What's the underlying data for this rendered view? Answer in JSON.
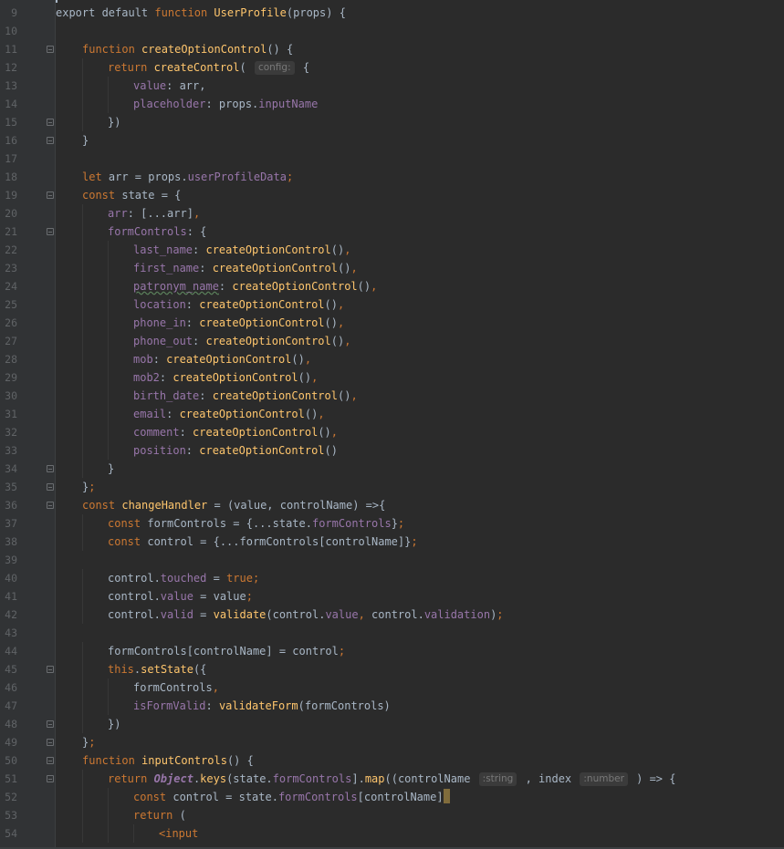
{
  "editor": {
    "lines": [
      {
        "num": "9",
        "indent": 0,
        "fold": false,
        "tokens": [
          [
            "plain",
            "export default "
          ],
          [
            "kw",
            "function "
          ],
          [
            "fn",
            "UserProfile"
          ],
          [
            "plain",
            "(props) {"
          ]
        ]
      },
      {
        "num": "10",
        "indent": 0,
        "fold": false,
        "tokens": []
      },
      {
        "num": "11",
        "indent": 1,
        "fold": true,
        "tokens": [
          [
            "kw",
            "function "
          ],
          [
            "fn",
            "createOptionControl"
          ],
          [
            "plain",
            "() {"
          ]
        ]
      },
      {
        "num": "12",
        "indent": 2,
        "fold": false,
        "tokens": [
          [
            "kw",
            "return "
          ],
          [
            "fn",
            "createControl"
          ],
          [
            "plain",
            "( "
          ],
          [
            "hint",
            "config:"
          ],
          [
            "plain",
            " {"
          ]
        ]
      },
      {
        "num": "13",
        "indent": 3,
        "fold": false,
        "tokens": [
          [
            "prop",
            "value"
          ],
          [
            "plain",
            ": arr,"
          ]
        ]
      },
      {
        "num": "14",
        "indent": 3,
        "fold": false,
        "tokens": [
          [
            "prop",
            "placeholder"
          ],
          [
            "plain",
            ": props."
          ],
          [
            "prop",
            "inputName"
          ]
        ]
      },
      {
        "num": "15",
        "indent": 2,
        "fold": true,
        "tokens": [
          [
            "plain",
            "})"
          ]
        ]
      },
      {
        "num": "16",
        "indent": 1,
        "fold": true,
        "tokens": [
          [
            "plain",
            "}"
          ]
        ]
      },
      {
        "num": "17",
        "indent": 0,
        "fold": false,
        "tokens": []
      },
      {
        "num": "18",
        "indent": 1,
        "fold": false,
        "tokens": [
          [
            "kw",
            "let "
          ],
          [
            "plain",
            "arr = props."
          ],
          [
            "prop",
            "userProfileData"
          ],
          [
            "kw",
            ";"
          ]
        ]
      },
      {
        "num": "19",
        "indent": 1,
        "fold": true,
        "tokens": [
          [
            "kw",
            "const "
          ],
          [
            "plain",
            "state = {"
          ]
        ]
      },
      {
        "num": "20",
        "indent": 2,
        "fold": false,
        "tokens": [
          [
            "prop",
            "arr"
          ],
          [
            "plain",
            ": [...arr]"
          ],
          [
            "kw",
            ","
          ]
        ]
      },
      {
        "num": "21",
        "indent": 2,
        "fold": true,
        "tokens": [
          [
            "prop",
            "formControls"
          ],
          [
            "plain",
            ": {"
          ]
        ]
      },
      {
        "num": "22",
        "indent": 3,
        "fold": false,
        "tokens": [
          [
            "prop",
            "last_name"
          ],
          [
            "plain",
            ": "
          ],
          [
            "fn",
            "createOptionControl"
          ],
          [
            "plain",
            "()"
          ],
          [
            "kw",
            ","
          ]
        ]
      },
      {
        "num": "23",
        "indent": 3,
        "fold": false,
        "tokens": [
          [
            "prop",
            "first_name"
          ],
          [
            "plain",
            ": "
          ],
          [
            "fn",
            "createOptionControl"
          ],
          [
            "plain",
            "()"
          ],
          [
            "kw",
            ","
          ]
        ]
      },
      {
        "num": "24",
        "indent": 3,
        "fold": false,
        "tokens": [
          [
            "propwarn",
            "patronym_name"
          ],
          [
            "plain",
            ": "
          ],
          [
            "fn",
            "createOptionControl"
          ],
          [
            "plain",
            "()"
          ],
          [
            "kw",
            ","
          ]
        ]
      },
      {
        "num": "25",
        "indent": 3,
        "fold": false,
        "tokens": [
          [
            "prop",
            "location"
          ],
          [
            "plain",
            ": "
          ],
          [
            "fn",
            "createOptionControl"
          ],
          [
            "plain",
            "()"
          ],
          [
            "kw",
            ","
          ]
        ]
      },
      {
        "num": "26",
        "indent": 3,
        "fold": false,
        "tokens": [
          [
            "prop",
            "phone_in"
          ],
          [
            "plain",
            ": "
          ],
          [
            "fn",
            "createOptionControl"
          ],
          [
            "plain",
            "()"
          ],
          [
            "kw",
            ","
          ]
        ]
      },
      {
        "num": "27",
        "indent": 3,
        "fold": false,
        "tokens": [
          [
            "prop",
            "phone_out"
          ],
          [
            "plain",
            ": "
          ],
          [
            "fn",
            "createOptionControl"
          ],
          [
            "plain",
            "()"
          ],
          [
            "kw",
            ","
          ]
        ]
      },
      {
        "num": "28",
        "indent": 3,
        "fold": false,
        "tokens": [
          [
            "prop",
            "mob"
          ],
          [
            "plain",
            ": "
          ],
          [
            "fn",
            "createOptionControl"
          ],
          [
            "plain",
            "()"
          ],
          [
            "kw",
            ","
          ]
        ]
      },
      {
        "num": "29",
        "indent": 3,
        "fold": false,
        "tokens": [
          [
            "prop",
            "mob2"
          ],
          [
            "plain",
            ": "
          ],
          [
            "fn",
            "createOptionControl"
          ],
          [
            "plain",
            "()"
          ],
          [
            "kw",
            ","
          ]
        ]
      },
      {
        "num": "30",
        "indent": 3,
        "fold": false,
        "tokens": [
          [
            "prop",
            "birth_date"
          ],
          [
            "plain",
            ": "
          ],
          [
            "fn",
            "createOptionControl"
          ],
          [
            "plain",
            "()"
          ],
          [
            "kw",
            ","
          ]
        ]
      },
      {
        "num": "31",
        "indent": 3,
        "fold": false,
        "tokens": [
          [
            "prop",
            "email"
          ],
          [
            "plain",
            ": "
          ],
          [
            "fn",
            "createOptionControl"
          ],
          [
            "plain",
            "()"
          ],
          [
            "kw",
            ","
          ]
        ]
      },
      {
        "num": "32",
        "indent": 3,
        "fold": false,
        "tokens": [
          [
            "prop",
            "comment"
          ],
          [
            "plain",
            ": "
          ],
          [
            "fn",
            "createOptionControl"
          ],
          [
            "plain",
            "()"
          ],
          [
            "kw",
            ","
          ]
        ]
      },
      {
        "num": "33",
        "indent": 3,
        "fold": false,
        "tokens": [
          [
            "prop",
            "position"
          ],
          [
            "plain",
            ": "
          ],
          [
            "fn",
            "createOptionControl"
          ],
          [
            "plain",
            "()"
          ]
        ]
      },
      {
        "num": "34",
        "indent": 2,
        "fold": true,
        "tokens": [
          [
            "plain",
            "}"
          ]
        ]
      },
      {
        "num": "35",
        "indent": 1,
        "fold": true,
        "tokens": [
          [
            "plain",
            "}"
          ],
          [
            "kw",
            ";"
          ]
        ]
      },
      {
        "num": "36",
        "indent": 1,
        "fold": true,
        "tokens": [
          [
            "kw",
            "const "
          ],
          [
            "fn",
            "changeHandler"
          ],
          [
            "plain",
            " = (value, controlName) =>{"
          ]
        ]
      },
      {
        "num": "37",
        "indent": 2,
        "fold": false,
        "tokens": [
          [
            "kw",
            "const "
          ],
          [
            "plain",
            "formControls = {...state."
          ],
          [
            "prop",
            "formControls"
          ],
          [
            "plain",
            "}"
          ],
          [
            "kw",
            ";"
          ]
        ]
      },
      {
        "num": "38",
        "indent": 2,
        "fold": false,
        "tokens": [
          [
            "kw",
            "const "
          ],
          [
            "plain",
            "control = {...formControls[controlName]}"
          ],
          [
            "kw",
            ";"
          ]
        ]
      },
      {
        "num": "39",
        "indent": 0,
        "fold": false,
        "tokens": []
      },
      {
        "num": "40",
        "indent": 2,
        "fold": false,
        "tokens": [
          [
            "plain",
            "control."
          ],
          [
            "prop",
            "touched"
          ],
          [
            "plain",
            " = "
          ],
          [
            "kw",
            "true;"
          ]
        ]
      },
      {
        "num": "41",
        "indent": 2,
        "fold": false,
        "tokens": [
          [
            "plain",
            "control."
          ],
          [
            "prop",
            "value"
          ],
          [
            "plain",
            " = value"
          ],
          [
            "kw",
            ";"
          ]
        ]
      },
      {
        "num": "42",
        "indent": 2,
        "fold": false,
        "tokens": [
          [
            "plain",
            "control."
          ],
          [
            "prop",
            "valid"
          ],
          [
            "plain",
            " = "
          ],
          [
            "fn",
            "validate"
          ],
          [
            "plain",
            "(control."
          ],
          [
            "prop",
            "value"
          ],
          [
            "kw",
            ", "
          ],
          [
            "plain",
            "control."
          ],
          [
            "prop",
            "validation"
          ],
          [
            "plain",
            ")"
          ],
          [
            "kw",
            ";"
          ]
        ]
      },
      {
        "num": "43",
        "indent": 0,
        "fold": false,
        "tokens": []
      },
      {
        "num": "44",
        "indent": 2,
        "fold": false,
        "tokens": [
          [
            "plain",
            "formControls[controlName] = control"
          ],
          [
            "kw",
            ";"
          ]
        ]
      },
      {
        "num": "45",
        "indent": 2,
        "fold": true,
        "tokens": [
          [
            "kw",
            "this"
          ],
          [
            "plain",
            "."
          ],
          [
            "fn",
            "setState"
          ],
          [
            "plain",
            "({"
          ]
        ]
      },
      {
        "num": "46",
        "indent": 3,
        "fold": false,
        "tokens": [
          [
            "plain",
            "formControls"
          ],
          [
            "kw",
            ","
          ]
        ]
      },
      {
        "num": "47",
        "indent": 3,
        "fold": false,
        "tokens": [
          [
            "prop",
            "isFormValid"
          ],
          [
            "plain",
            ": "
          ],
          [
            "fn",
            "validateForm"
          ],
          [
            "plain",
            "(formControls)"
          ]
        ]
      },
      {
        "num": "48",
        "indent": 2,
        "fold": true,
        "tokens": [
          [
            "plain",
            "})"
          ]
        ]
      },
      {
        "num": "49",
        "indent": 1,
        "fold": true,
        "tokens": [
          [
            "plain",
            "}"
          ],
          [
            "kw",
            ";"
          ]
        ]
      },
      {
        "num": "50",
        "indent": 1,
        "fold": true,
        "tokens": [
          [
            "kw",
            "function "
          ],
          [
            "fn",
            "inputControls"
          ],
          [
            "plain",
            "() {"
          ]
        ]
      },
      {
        "num": "51",
        "indent": 2,
        "fold": true,
        "tokens": [
          [
            "kw",
            "return "
          ],
          [
            "cls",
            "Object"
          ],
          [
            "plain",
            "."
          ],
          [
            "fn",
            "keys"
          ],
          [
            "plain",
            "(state."
          ],
          [
            "prop",
            "formControls"
          ],
          [
            "plain",
            "]."
          ],
          [
            "fn",
            "map"
          ],
          [
            "plain",
            "((controlName "
          ],
          [
            "hint",
            ":string"
          ],
          [
            "plain",
            " , index "
          ],
          [
            "hint",
            ":number"
          ],
          [
            "plain",
            " ) => {"
          ]
        ]
      },
      {
        "num": "52",
        "indent": 3,
        "fold": false,
        "tokens": [
          [
            "kw",
            "const "
          ],
          [
            "plain",
            "control = state."
          ],
          [
            "prop",
            "formControls"
          ],
          [
            "plain",
            "[controlName]"
          ],
          [
            "caret",
            ""
          ]
        ]
      },
      {
        "num": "53",
        "indent": 3,
        "fold": false,
        "tokens": [
          [
            "kw",
            "return "
          ],
          [
            "plain",
            "("
          ]
        ]
      },
      {
        "num": "54",
        "indent": 4,
        "fold": false,
        "tokens": [
          [
            "kw",
            "<input"
          ]
        ]
      }
    ]
  }
}
